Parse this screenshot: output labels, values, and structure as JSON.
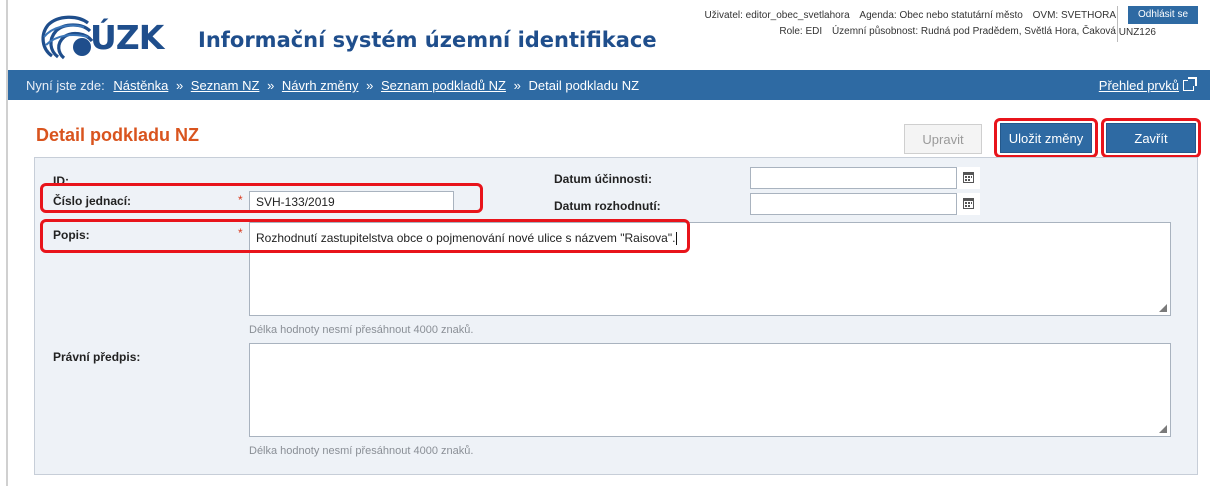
{
  "header": {
    "logo_text": "ÚZK",
    "app_title": "Informační systém územní identifikace",
    "user_line": {
      "user": "Uživatel: editor_obec_svetlahora",
      "agenda": "Agenda: Obec nebo statutární město",
      "ovm": "OVM: SVETHORA"
    },
    "role_line": {
      "role": "Role: EDI",
      "scope": "Územní působnost: Rudná pod Pradědem, Světlá Hora, Čaková"
    },
    "unz_code": "UNZ126",
    "logout_label": "Odhlásit se"
  },
  "breadcrumb": {
    "prefix": "Nyní jste zde:",
    "items": [
      "Nástěnka",
      "Seznam NZ",
      "Návrh změny",
      "Seznam podkladů NZ"
    ],
    "current": "Detail podkladu NZ",
    "separator": "»",
    "right_link": "Přehled prvků"
  },
  "page": {
    "title": "Detail podkladu NZ"
  },
  "actions": {
    "edit_label": "Upravit",
    "save_label": "Uložit změny",
    "close_label": "Zavřít"
  },
  "form": {
    "id_label": "ID:",
    "reference_label": "Číslo jednací:",
    "reference_value": "SVH-133/2019",
    "effective_date_label": "Datum účinnosti:",
    "effective_date_value": "",
    "decision_date_label": "Datum rozhodnutí:",
    "decision_date_value": "",
    "description_label": "Popis:",
    "description_value": "Rozhodnutí zastupitelstva obce o pojmenování nové ulice s názvem \"Raisova\".",
    "description_hint": "Délka hodnoty nesmí přesáhnout 4000 znaků.",
    "legal_label": "Právní předpis:",
    "legal_value": "",
    "legal_hint": "Délka hodnoty nesmí přesáhnout 4000 znaků.",
    "required_mark": "*"
  },
  "colors": {
    "brand_blue": "#2e6aa3",
    "title_orange": "#d9541e",
    "highlight_red": "#e8141b",
    "panel_bg": "#eef2f7"
  },
  "icons": {
    "calendar": "calendar-icon",
    "external_link": "external-link-icon",
    "logo_globe": "cuzk-globe-icon"
  }
}
